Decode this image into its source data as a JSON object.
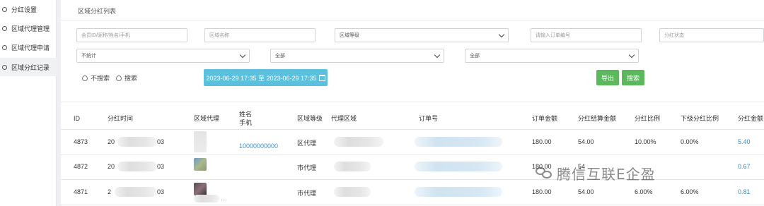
{
  "sidebar": {
    "items": [
      {
        "label": "分红设置"
      },
      {
        "label": "区域代理管理"
      },
      {
        "label": "区域代理申请"
      },
      {
        "label": "区域分红记录"
      }
    ]
  },
  "header": {
    "title": "区域分红列表"
  },
  "filters": {
    "member_placeholder": "会员ID/昵称/姓名/手机",
    "region_placeholder": "区域名称",
    "level_placeholder": "区域等级",
    "order_placeholder": "请输入订单编号",
    "status_placeholder": "分红状态",
    "stat_value": "不统计",
    "select2_value": "全部",
    "select3_value": "全部"
  },
  "search_mode": {
    "option1": "不搜索",
    "option2": "搜索"
  },
  "date_range": {
    "text": "2023-06-29 17:35 至 2023-06-29 17:35"
  },
  "actions": {
    "export_label": "导出",
    "search_label": "搜索"
  },
  "table": {
    "headers": {
      "id": "ID",
      "time": "分红时间",
      "agent": "区域代理",
      "name": "姓名",
      "phone": "手机",
      "level": "区域等级",
      "region": "代理区域",
      "order": "订单号",
      "amount": "订单金额",
      "settle": "分红结算金额",
      "ratio": "分红比例",
      "sub_ratio": "下级分红比例",
      "bonus": "分红金额"
    },
    "rows": [
      {
        "id": "4873",
        "time_pre": "20",
        "time_post": "03",
        "phone": "10000000000",
        "level": "区代理",
        "amount": "180.00",
        "settle": "54.00",
        "ratio": "10.00%",
        "sub_ratio": "0.00%",
        "bonus": "5.40"
      },
      {
        "id": "4872",
        "time_pre": "20",
        "time_post": "03",
        "phone": "",
        "level": "市代理",
        "amount": "180.00",
        "settle": "54",
        "ratio": "",
        "sub_ratio": "",
        "bonus": "0.67"
      },
      {
        "id": "4871",
        "time_pre": "2",
        "time_post": "03",
        "phone": "",
        "agent_suffix": "…",
        "level": "市代理",
        "amount": "180.00",
        "settle": "54.00",
        "ratio": "6.00%",
        "sub_ratio": "6.00%",
        "bonus": "0.81"
      }
    ]
  },
  "watermark": {
    "text": "腾信互联E企盈"
  }
}
